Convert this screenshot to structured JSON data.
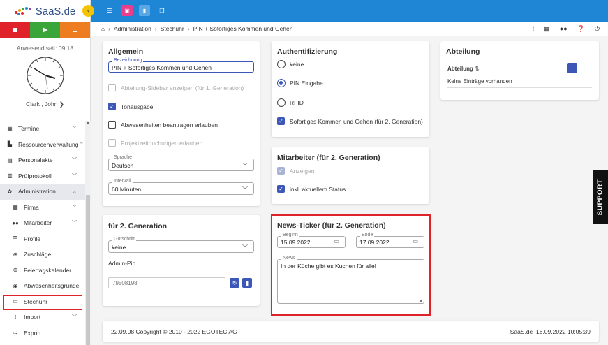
{
  "app": {
    "logo": "SaaS.de"
  },
  "sidebar": {
    "anwesend": "Anwesend seit: 09:18",
    "user": "Clark , John",
    "items": [
      {
        "label": "Termine",
        "icon": "calendar-icon"
      },
      {
        "label": "Ressourcenverwaltung",
        "icon": "resources-icon"
      },
      {
        "label": "Personalakte",
        "icon": "file-icon"
      },
      {
        "label": "Prüfprotokoll",
        "icon": "protocol-icon"
      },
      {
        "label": "Administration",
        "icon": "gear-icon"
      },
      {
        "label": "Firma",
        "icon": "building-icon"
      },
      {
        "label": "Mitarbeiter",
        "icon": "users-icon"
      },
      {
        "label": "Profile",
        "icon": "profile-icon"
      },
      {
        "label": "Zuschläge",
        "icon": "plus-circle-icon"
      },
      {
        "label": "Feiertagskalender",
        "icon": "globe-icon"
      },
      {
        "label": "Abwesenheitsgründe",
        "icon": "settings-circle-icon"
      },
      {
        "label": "Stechuhr",
        "icon": "monitor-icon"
      },
      {
        "label": "Import",
        "icon": "import-icon"
      },
      {
        "label": "Export",
        "icon": "export-icon"
      }
    ]
  },
  "breadcrumb": {
    "items": [
      "Administration",
      "Stechuhr",
      "PIN + Sofortiges Kommen und Gehen"
    ]
  },
  "allgemein": {
    "title": "Allgemein",
    "bezeichnung_label": "Bezeichnung",
    "bezeichnung_value": "PIN + Sofortiges Kommen und Gehen",
    "cb_abteilung": "Abteilung-Sidebar anzeigen (für 1. Generation)",
    "cb_ton": "Tonausgabe",
    "cb_abw": "Abwesenheiten beantragen erlauben",
    "cb_projekt": "Projektzeitbuchungen erlauben",
    "sprache_label": "Sprache",
    "sprache_value": "Deutsch",
    "intervall_label": "Intervall",
    "intervall_value": "60 Minuten"
  },
  "gen2": {
    "title": "für 2. Generation",
    "gutschrift_label": "Gutschrift",
    "gutschrift_value": "keine",
    "admin_pin_label": "Admin-Pin",
    "admin_pin_placeholder": "79508198"
  },
  "auth": {
    "title": "Authentifizierung",
    "opt_keine": "keine",
    "opt_pin": "PIN Eingabe",
    "opt_rfid": "RFID",
    "cb_sofort": "Sofortiges Kommen und Gehen (für 2. Generation)"
  },
  "mitarbeiter": {
    "title": "Mitarbeiter (für 2. Generation)",
    "cb_anzeigen": "Anzeigen",
    "cb_status": "inkl. aktuellem Status"
  },
  "news": {
    "title": "News-Ticker (für 2. Generation)",
    "beginn_label": "Beginn",
    "beginn_value": "15.09.2022",
    "ende_label": "Ende",
    "ende_value": "17.09.2022",
    "news_label": "News",
    "news_value": "In der Küche gibt es Kuchen für alle!"
  },
  "abteilung": {
    "title": "Abteilung",
    "col": "Abteilung",
    "empty": "Keine Einträge vorhanden"
  },
  "footer": {
    "copyright": "22.09.08 Copyright © 2010 - 2022 EGOTEC AG",
    "right": "SaaS.de  16.09.2022 10:05:39"
  },
  "support": {
    "label": "SUPPORT"
  }
}
